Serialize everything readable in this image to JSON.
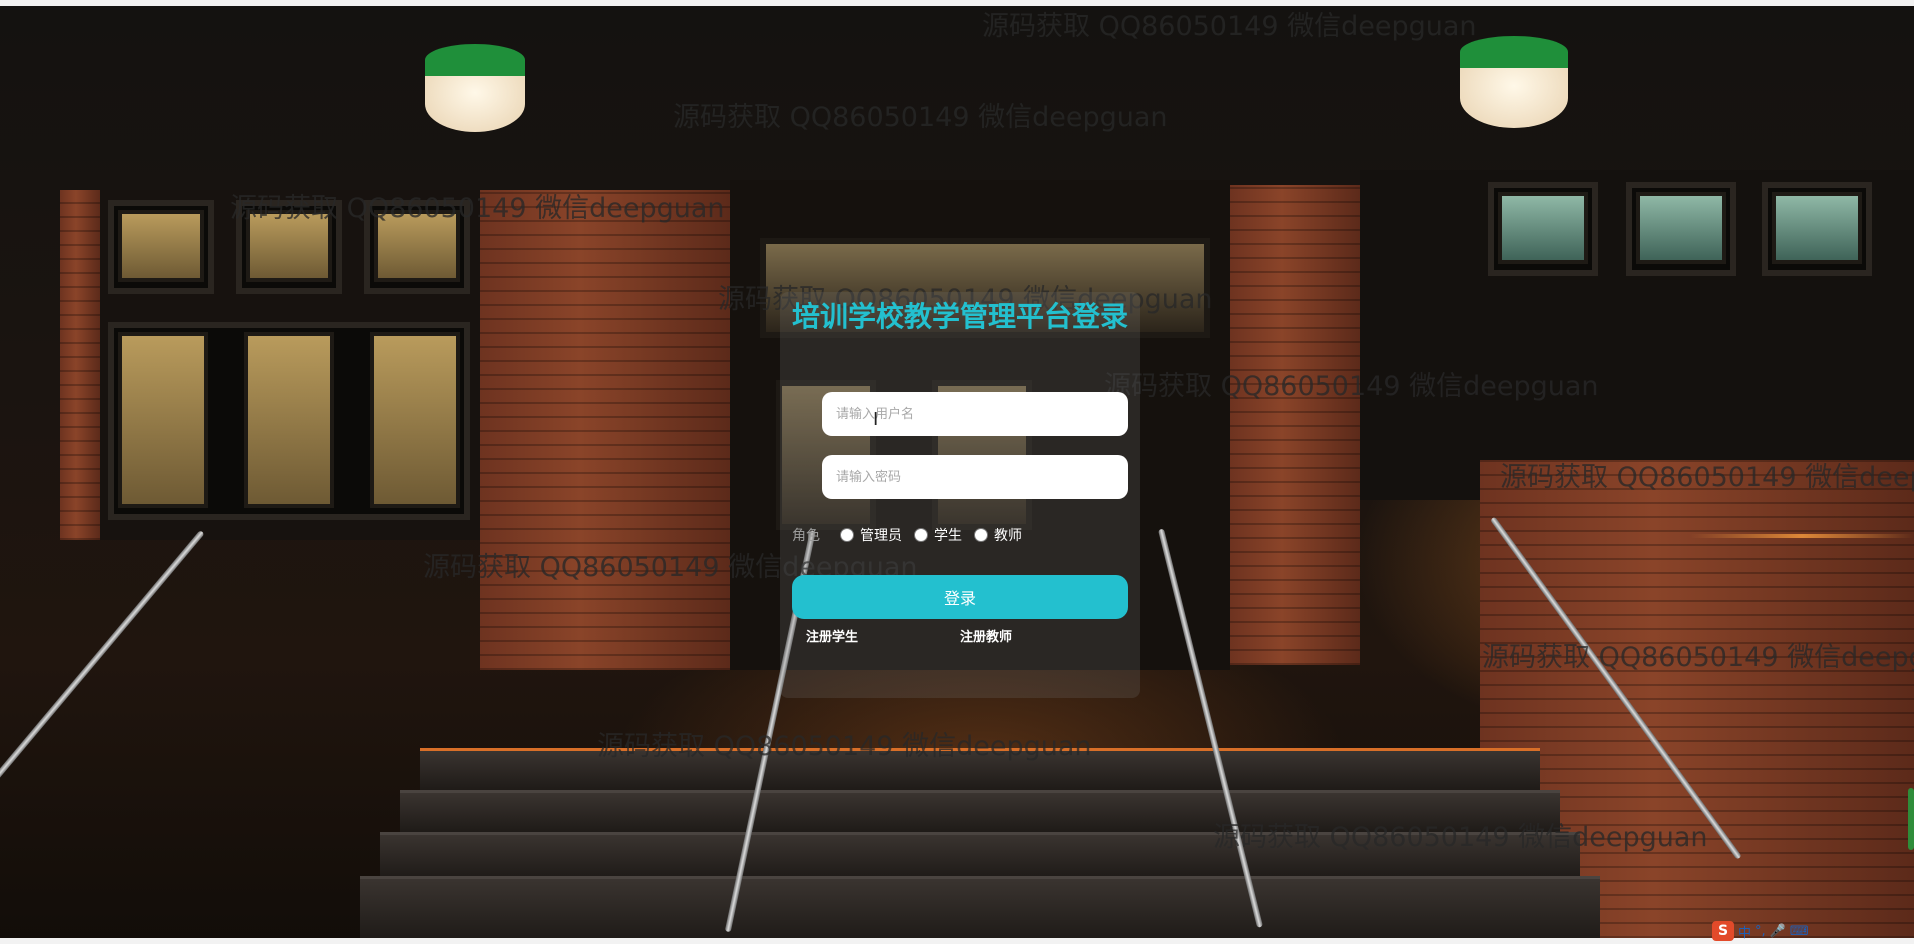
{
  "login": {
    "title": "培训学校教学管理平台登录",
    "username_placeholder": "请输入用户名",
    "password_placeholder": "请输入密码",
    "role_label": "角色",
    "roles": [
      "管理员",
      "学生",
      "教师"
    ],
    "submit_label": "登录",
    "register_student": "注册学生",
    "register_teacher": "注册教师"
  },
  "watermark": {
    "text": "源码获取 QQ86050149 微信deepguan"
  },
  "tray": {
    "logo": "S",
    "lang": "中",
    "punct": "°,"
  },
  "colors": {
    "accent": "#23c0cf",
    "lamp_green": "#1f8f3a"
  },
  "icons": [
    "text-cursor-icon",
    "sogou-ime-icon",
    "mic-icon",
    "keyboard-icon"
  ]
}
